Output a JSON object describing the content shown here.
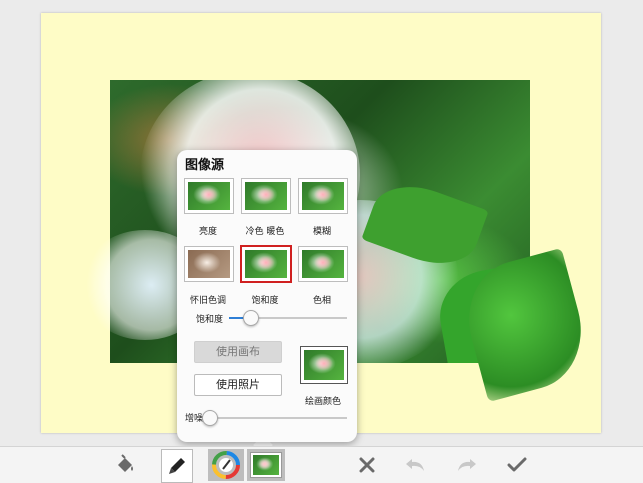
{
  "popover": {
    "title": "图像源",
    "thumbnails": [
      {
        "label": "亮度"
      },
      {
        "label": "冷色 暖色"
      },
      {
        "label": "模糊"
      },
      {
        "label": "怀旧色调"
      },
      {
        "label": "饱和度"
      },
      {
        "label": "色相"
      }
    ],
    "saturation": {
      "label": "饱和度",
      "value_percent": 18
    },
    "use_canvas_label": "使用画布",
    "use_photo_label": "使用照片",
    "paint_color_label": "绘画颜色",
    "noise": {
      "label": "增噪",
      "value_percent": 3
    }
  },
  "toolbar": {
    "icons": [
      "paint-bucket-icon",
      "brush-icon",
      "color-wheel-icon",
      "image-source-icon",
      "close-icon",
      "undo-icon",
      "redo-icon",
      "check-icon"
    ]
  },
  "colors": {
    "paper": "#fefcc6",
    "selected_border": "#d02020",
    "slider_fill": "#2f7fd6"
  }
}
